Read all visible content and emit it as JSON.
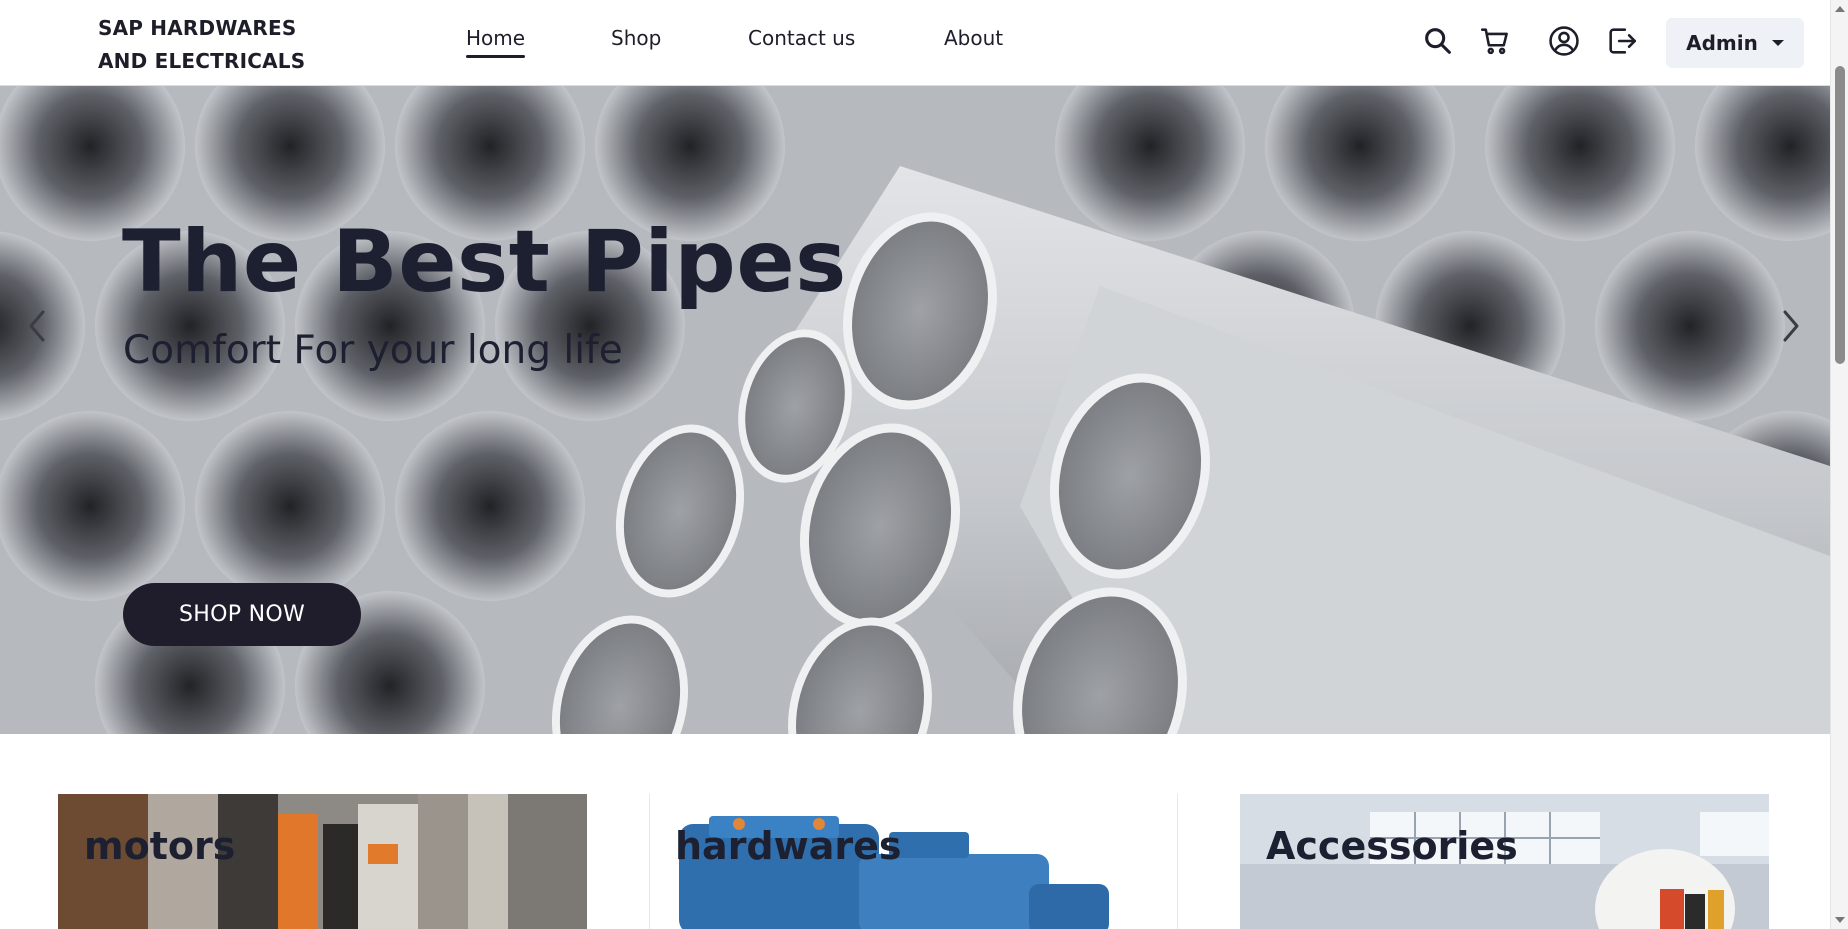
{
  "header": {
    "brand_line1": "SAP HARDWARES",
    "brand_line2": "AND ELECTRICALS",
    "nav": [
      {
        "label": "Home",
        "active": true
      },
      {
        "label": "Shop",
        "active": false
      },
      {
        "label": "Contact us",
        "active": false
      },
      {
        "label": "About",
        "active": false
      }
    ],
    "icons": [
      "search-icon",
      "cart-icon",
      "user-circle-icon",
      "logout-icon"
    ],
    "admin_label": "Admin"
  },
  "hero": {
    "title": "The Best Pipes",
    "subtitle": "Comfort For your long life",
    "cta_label": "SHOP NOW"
  },
  "categories": [
    {
      "label": "motors"
    },
    {
      "label": "hardwares"
    },
    {
      "label": "Accessories"
    }
  ],
  "colors": {
    "text_dark": "#1d2030",
    "button_dark": "#1f1d2b",
    "admin_bg": "#eef2f6"
  }
}
